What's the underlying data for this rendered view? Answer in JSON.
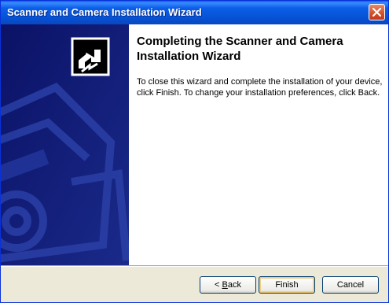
{
  "window": {
    "title": "Scanner and Camera Installation Wizard"
  },
  "content": {
    "heading": "Completing the Scanner and Camera Installation Wizard",
    "description": "To close this wizard and complete the installation of your device, click Finish. To change your installation preferences, click Back."
  },
  "buttons": {
    "back_prefix": "< ",
    "back_accel": "B",
    "back_rest": "ack",
    "finish": "Finish",
    "cancel": "Cancel"
  },
  "icons": {
    "close": "close-icon",
    "wizard": "wizard-arrow-icon",
    "camera": "camera-watermark"
  },
  "colors": {
    "titlebar": "#0553d6",
    "sidebar": "#10186a",
    "close_button": "#d14f2a",
    "default_button_focus": "#f7c964"
  }
}
